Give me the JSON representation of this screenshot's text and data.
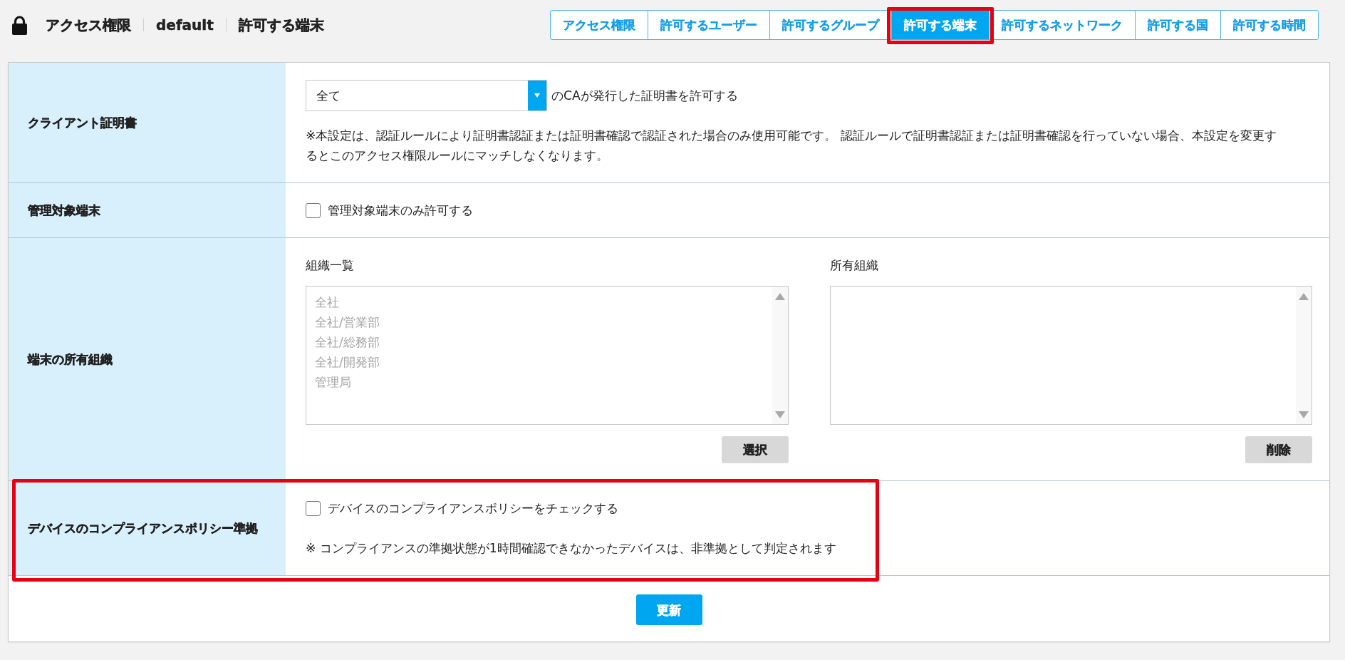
{
  "header": {
    "title": "アクセス権限",
    "profile": "default",
    "page": "許可する端末"
  },
  "tabs": [
    {
      "label": "アクセス権限",
      "selected": false,
      "highlighted": false
    },
    {
      "label": "許可するユーザー",
      "selected": false,
      "highlighted": false
    },
    {
      "label": "許可するグループ",
      "selected": false,
      "highlighted": false
    },
    {
      "label": "許可する端末",
      "selected": true,
      "highlighted": true
    },
    {
      "label": "許可するネットワーク",
      "selected": false,
      "highlighted": false
    },
    {
      "label": "許可する国",
      "selected": false,
      "highlighted": false
    },
    {
      "label": "許可する時間",
      "selected": false,
      "highlighted": false
    }
  ],
  "settings": [
    {
      "kind": "certificate",
      "label": "クライアント証明書",
      "highlighted": false,
      "select": {
        "value": "全て"
      },
      "select_suffix": "のCAが発行した証明書を許可する",
      "note": "※本設定は、認証ルールにより証明書認証または証明書確認で認証された場合のみ使用可能です。 認証ルールで証明書認証または証明書確認を行っていない場合、本設定を変更するとこのアクセス権限ルールにマッチしなくなります。"
    },
    {
      "kind": "checkbox",
      "label": "管理対象端末",
      "highlighted": false,
      "checkbox": {
        "label": "管理対象端末のみ許可する",
        "checked": false
      }
    },
    {
      "kind": "organizations",
      "label": "端末の所有組織",
      "highlighted": false,
      "lists": [
        {
          "label": "組織一覧",
          "items": [
            "全社",
            "全社/営業部",
            "全社/総務部",
            "全社/開発部",
            "管理局"
          ],
          "button": "選択"
        },
        {
          "label": "所有組織",
          "button": "削除"
        }
      ]
    },
    {
      "kind": "checkbox",
      "label": "デバイスのコンプライアンスポリシー準拠",
      "highlighted": true,
      "checkbox": {
        "label": "デバイスのコンプライアンスポリシーをチェックする",
        "checked": false
      },
      "note": "※ コンプライアンスの準拠状態が1時間確認できなかったデバイスは、非準拠として判定されます"
    }
  ],
  "submit_button": "更新"
}
